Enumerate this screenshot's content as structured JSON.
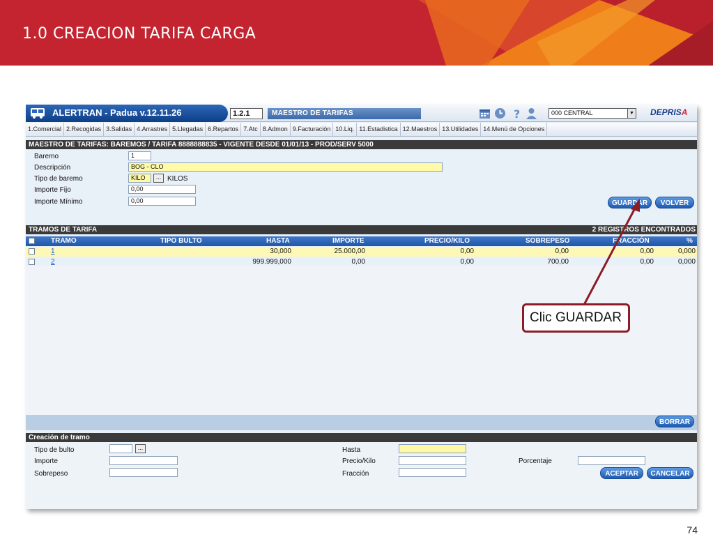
{
  "slide": {
    "title": "1.0 CREACION TARIFA CARGA",
    "page_number": "74"
  },
  "app": {
    "name": "ALERTRAN - Padua  v.12.11.26",
    "screen_code": "1.2.1",
    "screen_title": "MAESTRO DE TARIFAS",
    "branch": "000 CENTRAL",
    "brand": {
      "main": "DEPRIS",
      "accent": "A"
    },
    "icons": [
      "calendar-icon",
      "clock-icon",
      "help-icon",
      "user-icon"
    ]
  },
  "menu": [
    "1.Comercial",
    "2.Recogidas",
    "3.Salidas",
    "4.Arrastres",
    "5.Llegadas",
    "6.Repartos",
    "7.Atc",
    "8.Admon",
    "9.Facturación",
    "10.Liq.",
    "11.Estadistica",
    "12.Maestros",
    "13.Utilidades",
    "14.Menú de Opciones"
  ],
  "header_section": {
    "title": "MAESTRO DE TARIFAS: BAREMOS   /   TARIFA 8888888835   -   VIGENTE DESDE 01/01/13   -   PROD/SERV 5000"
  },
  "form": {
    "baremo": {
      "label": "Baremo",
      "value": "1"
    },
    "descripcion": {
      "label": "Descripción",
      "value": "BOG - CLO"
    },
    "tipo_baremo": {
      "label": "Tipo de baremo",
      "value": "KILO",
      "dots": "...",
      "desc": "KILOS"
    },
    "importe_fijo": {
      "label": "Importe Fijo",
      "value": "0,00"
    },
    "importe_minimo": {
      "label": "Importe Mínimo",
      "value": "0,00"
    }
  },
  "buttons": {
    "guardar": "GUARDAR",
    "volver": "VOLVER",
    "borrar": "BORRAR",
    "aceptar": "ACEPTAR",
    "cancelar": "CANCELAR"
  },
  "tramos": {
    "title": "TRAMOS DE TARIFA",
    "count": "2 REGISTROS ENCONTRADOS",
    "columns": [
      "TRAMO",
      "TIPO BULTO",
      "HASTA",
      "IMPORTE",
      "PRECIO/KILO",
      "SOBREPESO",
      "FRACCIÓN",
      "%"
    ],
    "rows": [
      {
        "tramo": "1",
        "tipo_bulto": "",
        "hasta": "30,000",
        "importe": "25.000,00",
        "precio_kilo": "0,00",
        "sobrepeso": "0,00",
        "fraccion": "0,00",
        "pct": "0,000"
      },
      {
        "tramo": "2",
        "tipo_bulto": "",
        "hasta": "999.999,000",
        "importe": "0,00",
        "precio_kilo": "0,00",
        "sobrepeso": "700,00",
        "fraccion": "0,00",
        "pct": "0,000"
      }
    ]
  },
  "creacion": {
    "title": "Creación de tramo",
    "tipo_bulto": {
      "label": "Tipo de bulto",
      "value": "",
      "dots": "..."
    },
    "importe": {
      "label": "Importe",
      "value": ""
    },
    "sobrepeso": {
      "label": "Sobrepeso",
      "value": ""
    },
    "hasta": {
      "label": "Hasta",
      "value": ""
    },
    "precio_kilo": {
      "label": "Precio/Kilo",
      "value": ""
    },
    "fraccion": {
      "label": "Fracción",
      "value": ""
    },
    "porcentaje": {
      "label": "Porcentaje",
      "value": ""
    }
  },
  "callout": {
    "text": "Clic GUARDAR"
  },
  "colors": {
    "slide_red": "#c3242f",
    "app_blue": "#1f56a8",
    "callout_border": "#8b1c28",
    "highlight_yellow": "#fffaa8"
  }
}
